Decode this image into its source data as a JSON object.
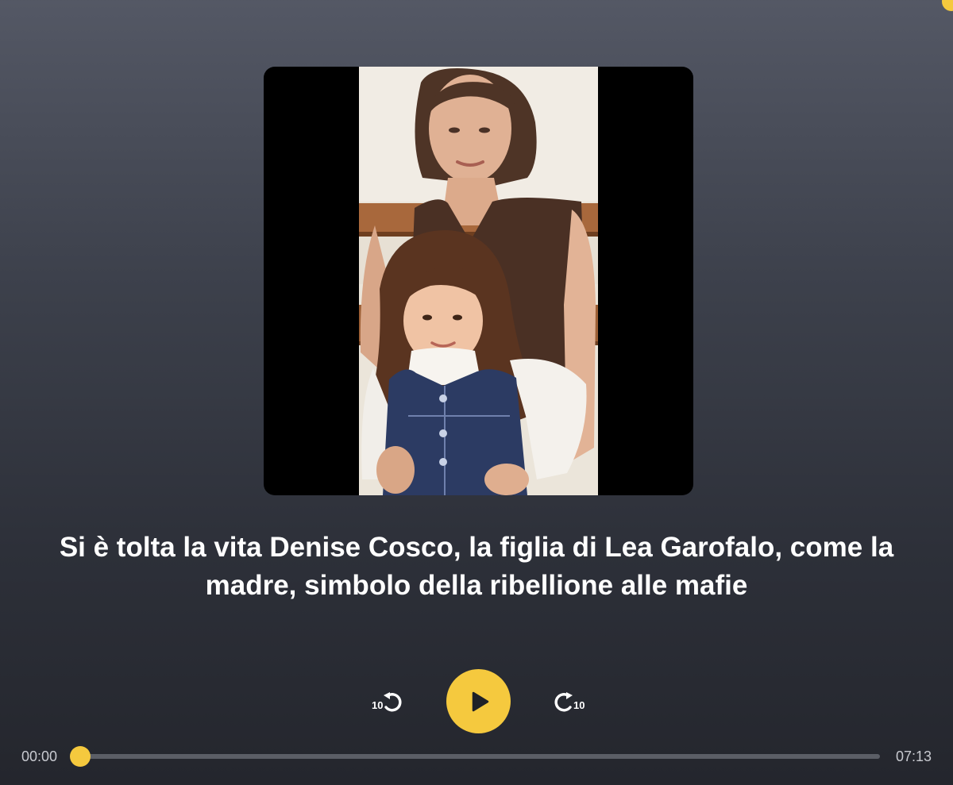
{
  "episode": {
    "title": "Si è tolta la vita Denise Cosco, la figlia di Lea Garofalo, come la madre, simbolo della ribellione alle mafie",
    "artwork": "photo-mother-and-daughter"
  },
  "controls": {
    "skip_back_label": "10",
    "skip_forward_label": "10",
    "skip_back_icon": "rewind-10-icon",
    "skip_forward_icon": "forward-10-icon",
    "play_icon": "play-icon"
  },
  "progress": {
    "current_time": "00:00",
    "total_time": "07:13",
    "fraction": 0.0
  },
  "colors": {
    "accent": "#f5c93e",
    "background_top": "#545865",
    "background_bottom": "#24262d",
    "track": "#5b5e66",
    "text": "#ffffff",
    "time_text": "#c8cad0"
  }
}
